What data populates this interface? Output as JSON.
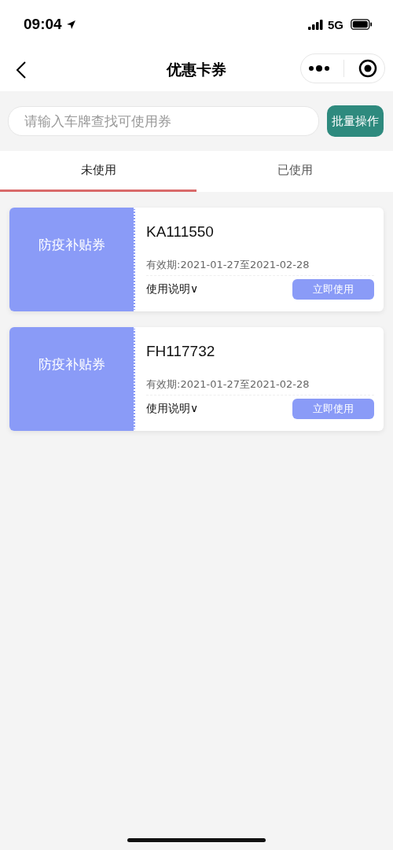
{
  "status_bar": {
    "time": "09:04",
    "network": "5G"
  },
  "nav": {
    "title": "优惠卡券"
  },
  "search": {
    "placeholder": "请输入车牌查找可使用券"
  },
  "batch_button": "批量操作",
  "tabs": [
    {
      "label": "未使用",
      "selected": true
    },
    {
      "label": "已使用",
      "selected": false
    }
  ],
  "coupons": [
    {
      "name": "防疫补贴券",
      "plate": "KA111550",
      "validity": "有效期:2021-01-27至2021-02-28",
      "instructions": "使用说明∨",
      "action": "立即使用"
    },
    {
      "name": "防疫补贴券",
      "plate": "FH117732",
      "validity": "有效期:2021-01-27至2021-02-28",
      "instructions": "使用说明∨",
      "action": "立即使用"
    }
  ]
}
